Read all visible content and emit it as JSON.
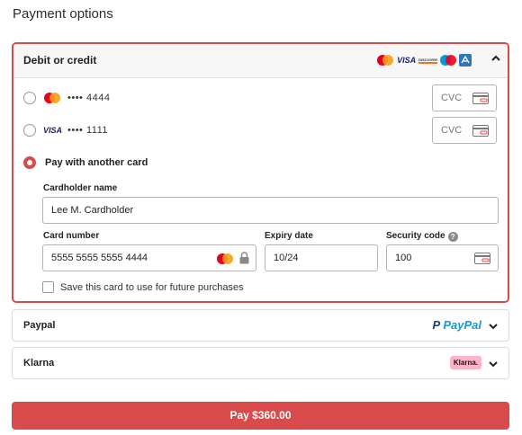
{
  "page": {
    "title": "Payment options"
  },
  "card_section": {
    "title": "Debit or credit",
    "brands": [
      "mastercard",
      "visa",
      "discover",
      "maestro",
      "amex"
    ],
    "brand_labels": {
      "visa": "VISA",
      "discover": "DISCOVER"
    },
    "saved_cards": [
      {
        "brand": "mastercard",
        "masked": "•••• 4444",
        "cvc_placeholder": "CVC",
        "selected": false
      },
      {
        "brand": "visa",
        "brand_label": "VISA",
        "masked": "•••• 1111",
        "cvc_placeholder": "CVC",
        "selected": false
      }
    ],
    "another_card": {
      "label": "Pay with another card",
      "selected": true,
      "cardholder_label": "Cardholder name",
      "cardholder_value": "Lee M. Cardholder",
      "card_number_label": "Card number",
      "card_number_value": "5555 5555 5555 4444",
      "expiry_label": "Expiry date",
      "expiry_value": "10/24",
      "security_label": "Security code",
      "security_help": "?",
      "security_value": "100",
      "save_label": "Save this card to use for future purchases",
      "save_checked": false
    }
  },
  "paypal": {
    "label": "Paypal",
    "logo_text": "PayPal"
  },
  "klarna": {
    "label": "Klarna",
    "logo_text": "Klarna."
  },
  "pay_button": {
    "label": "Pay $360.00"
  },
  "colors": {
    "accent": "#d94a4a",
    "paypal_dark": "#253b80",
    "paypal_light": "#179bd7",
    "klarna_pink": "#ffb3c7"
  }
}
